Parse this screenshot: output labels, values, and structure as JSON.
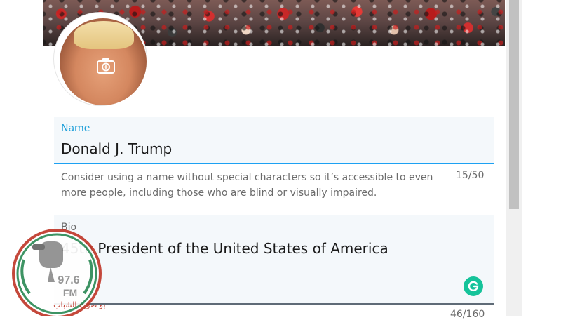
{
  "header": {
    "banner_name": "crowd-header-photo"
  },
  "profile": {
    "avatar_icon": "camera-icon",
    "name_field": {
      "label": "Name",
      "value": "Donald J. Trump",
      "help": "Consider using a name without special characters so it’s accessible to even more people, including those who are blind or visually impaired.",
      "count": "15/50"
    },
    "bio_field": {
      "label": "Bio",
      "value": "45th President of the United States of America",
      "count": "46/160",
      "assistant_icon": "grammarly-icon"
    }
  },
  "watermark": {
    "frequency": "97.6",
    "band": "FM",
    "station_text": "راديو صوت الشباب"
  },
  "colors": {
    "accent": "#1da1f2",
    "field_bg": "#f4f8fb",
    "grammarly": "#15c39a"
  }
}
